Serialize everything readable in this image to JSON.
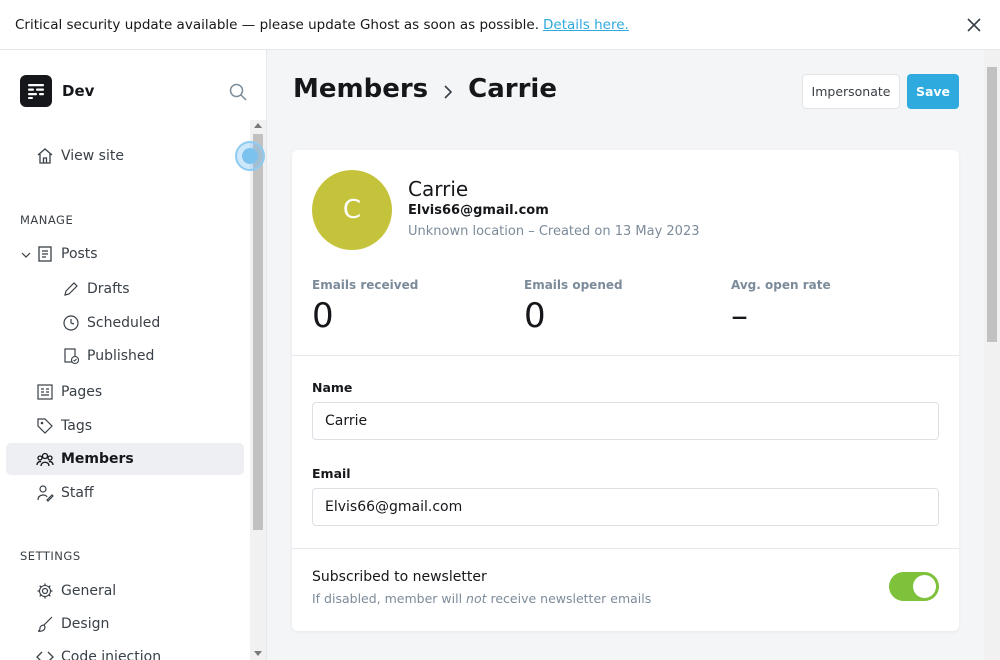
{
  "alert": {
    "message": "Critical security update available — please update Ghost as soon as possible.",
    "link_text": "Details here."
  },
  "sidebar": {
    "brand": "Dev",
    "view_site": "View site",
    "manage_header": "MANAGE",
    "settings_header": "SETTINGS",
    "items": {
      "posts": "Posts",
      "drafts": "Drafts",
      "scheduled": "Scheduled",
      "published": "Published",
      "pages": "Pages",
      "tags": "Tags",
      "members": "Members",
      "staff": "Staff",
      "general": "General",
      "design": "Design",
      "code_injection": "Code injection"
    }
  },
  "header": {
    "crumb_parent": "Members",
    "crumb_current": "Carrie",
    "impersonate_label": "Impersonate",
    "save_label": "Save"
  },
  "member": {
    "initial": "C",
    "name": "Carrie",
    "email": "Elvis66@gmail.com",
    "meta": "Unknown location – Created on 13 May 2023",
    "avatar_color": "#c5c33c"
  },
  "stats": {
    "received_label": "Emails received",
    "received_value": "0",
    "opened_label": "Emails opened",
    "opened_value": "0",
    "rate_label": "Avg. open rate",
    "rate_value": "–"
  },
  "form": {
    "name_label": "Name",
    "name_value": "Carrie",
    "email_label": "Email",
    "email_value": "Elvis66@gmail.com"
  },
  "newsletter": {
    "title": "Subscribed to newsletter",
    "desc_pre": "If disabled, member will ",
    "desc_em": "not",
    "desc_post": " receive newsletter emails",
    "enabled": true
  },
  "colors": {
    "accent": "#2eaadf",
    "toggle_on": "#7ec13a"
  }
}
